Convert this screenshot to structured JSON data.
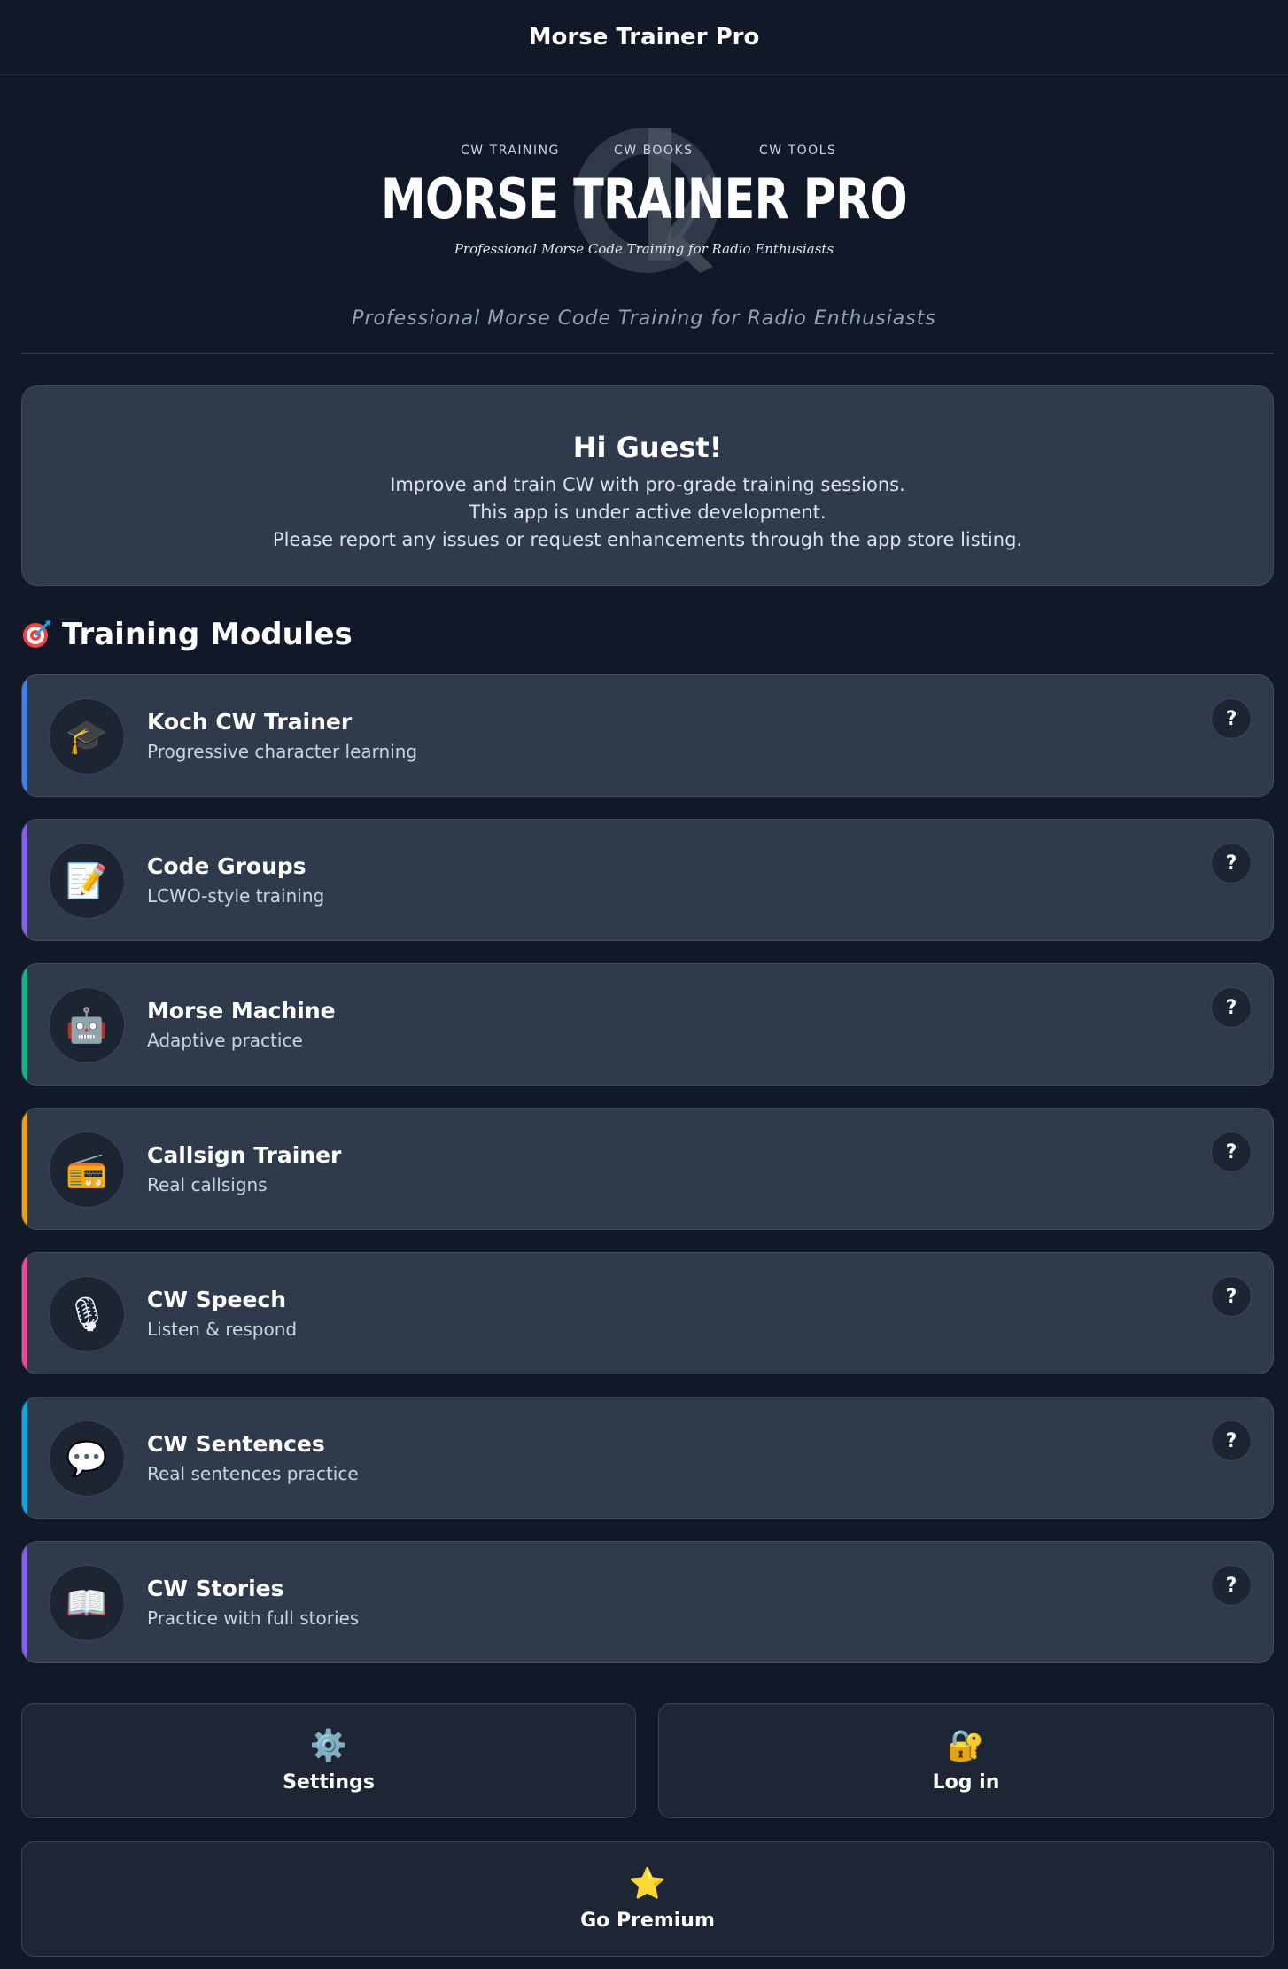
{
  "app": {
    "title": "Morse Trainer Pro"
  },
  "logo": {
    "nav": [
      "CW TRAINING",
      "CW BOOKS",
      "CW TOOLS"
    ],
    "wordmark": "MORSE TRAINER PRO",
    "tagline": "Professional Morse Code Training for Radio Enthusiasts"
  },
  "subtitle": "Professional Morse Code Training for Radio Enthusiasts",
  "welcome": {
    "title": "Hi Guest!",
    "lines": [
      "Improve and train CW with pro-grade training sessions.",
      "This app is under active development.",
      "Please report any issues or request enhancements through the app store listing."
    ]
  },
  "section": {
    "icon": "target-icon",
    "title": "Training Modules"
  },
  "modules": [
    {
      "title": "Koch CW Trainer",
      "subtitle": "Progressive character learning",
      "icon": "graduation-cap-icon",
      "glyph": "🎓",
      "accent": "#3b82f6",
      "help": "?"
    },
    {
      "title": "Code Groups",
      "subtitle": "LCWO-style training",
      "icon": "memo-icon",
      "glyph": "📝",
      "accent": "#8b5cf6",
      "help": "?"
    },
    {
      "title": "Morse Machine",
      "subtitle": "Adaptive practice",
      "icon": "robot-icon",
      "glyph": "🤖",
      "accent": "#10b981",
      "help": "?"
    },
    {
      "title": "Callsign Trainer",
      "subtitle": "Real callsigns",
      "icon": "radio-icon",
      "glyph": "📻",
      "accent": "#f59e0b",
      "help": "?"
    },
    {
      "title": "CW Speech",
      "subtitle": "Listen & respond",
      "icon": "microphone-icon",
      "glyph": "🎙",
      "accent": "#ec4899",
      "help": "?"
    },
    {
      "title": "CW Sentences",
      "subtitle": "Real sentences practice",
      "icon": "speech-bubble-icon",
      "glyph": "💬",
      "accent": "#0ea5e9",
      "help": "?"
    },
    {
      "title": "CW Stories",
      "subtitle": "Practice with full stories",
      "icon": "open-book-icon",
      "glyph": "📖",
      "accent": "#8b5cf6",
      "help": "?"
    }
  ],
  "actions": {
    "settings": {
      "label": "Settings",
      "icon": "gear-icon",
      "glyph": "⚙️"
    },
    "login": {
      "label": "Log in",
      "icon": "lock-key-icon",
      "glyph": "🔐"
    },
    "premium": {
      "label": "Go Premium",
      "icon": "star-icon",
      "glyph": "⭐"
    }
  }
}
